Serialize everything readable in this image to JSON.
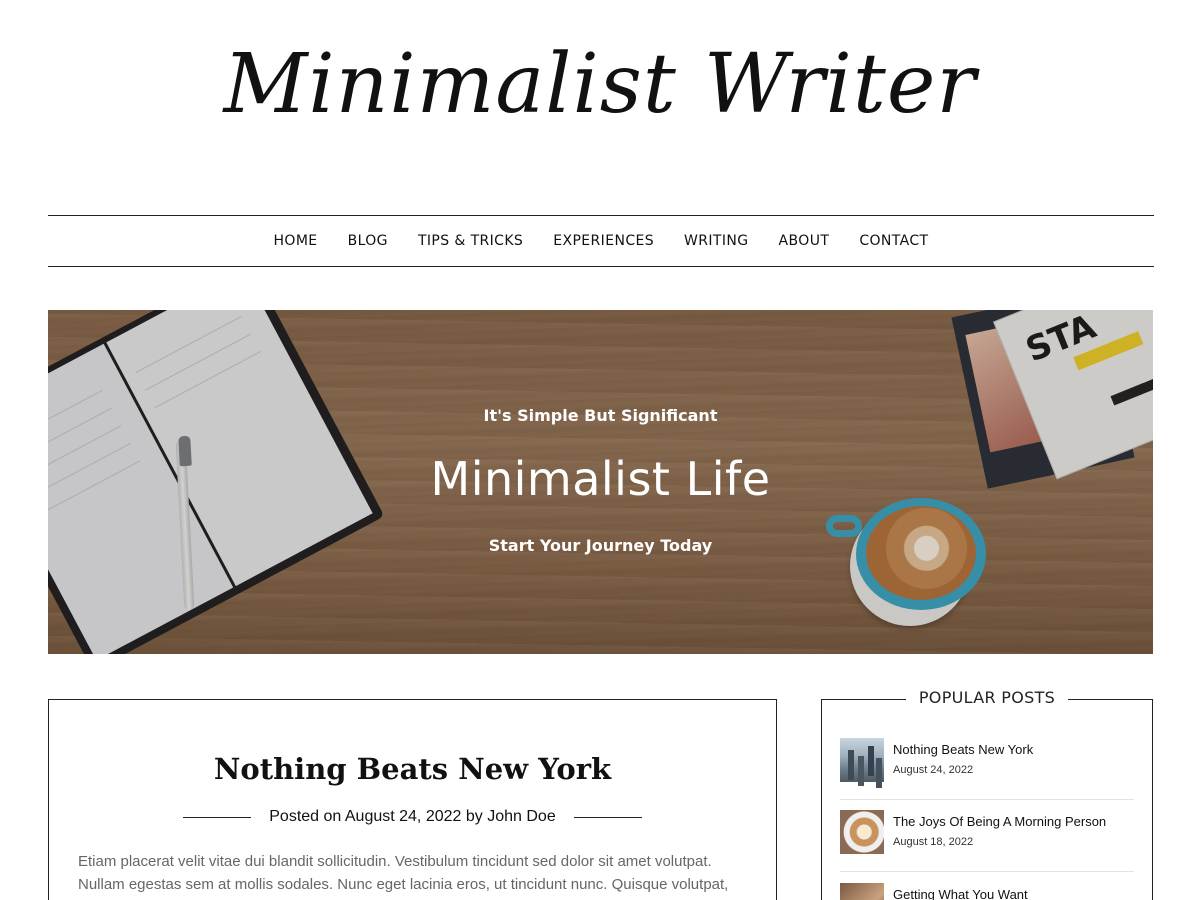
{
  "site": {
    "title": "Minimalist Writer"
  },
  "nav": {
    "items": [
      "HOME",
      "BLOG",
      "TIPS & TRICKS",
      "EXPERIENCES",
      "WRITING",
      "ABOUT",
      "CONTACT"
    ]
  },
  "hero": {
    "kicker": "It's Simple But Significant",
    "title": "Minimalist Life",
    "subtitle": "Start Your Journey Today"
  },
  "post": {
    "title": "Nothing Beats New York",
    "posted_on_label": "Posted on",
    "date": "August 24, 2022",
    "by_label": "by",
    "author": "John Doe",
    "excerpt": "Etiam placerat velit vitae dui blandit sollicitudin. Vestibulum tincidunt sed dolor sit amet volutpat. Nullam egestas sem at mollis sodales. Nunc eget lacinia eros, ut tincidunt nunc. Quisque volutpat, enim"
  },
  "sidebar": {
    "popular_posts": {
      "title": "POPULAR POSTS",
      "items": [
        {
          "title": "Nothing Beats New York",
          "date": "August 24, 2022"
        },
        {
          "title": "The Joys Of Being A Morning Person",
          "date": "August 18, 2022"
        },
        {
          "title": "Getting What You Want",
          "date": ""
        }
      ]
    }
  }
}
